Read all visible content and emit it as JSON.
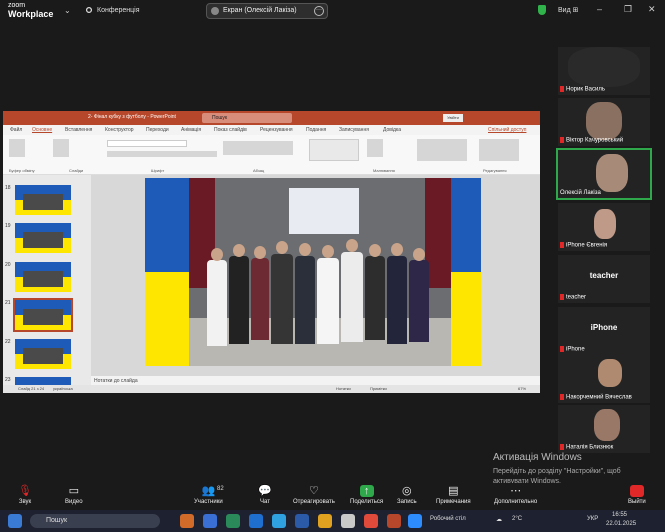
{
  "app": {
    "logo_line1": "zoom",
    "logo_line2": "Workplace",
    "conference_label": "Конференція"
  },
  "share_pill": {
    "label": "Екран (Олексій Лакіза)"
  },
  "topbar": {
    "view_label": "Вид"
  },
  "powerpoint": {
    "title": "2- Фінал кубку з футболу  -  PowerPoint",
    "search": "Пошук",
    "signin": "Увійти",
    "tabs": [
      "Файл",
      "Основне",
      "Вставлення",
      "Конструктор",
      "Переходи",
      "Анімація",
      "Показ слайдів",
      "Рецензування",
      "Подання",
      "Записування",
      "Довідка"
    ],
    "share_label": "Спільний доступ",
    "ribbon_groups": [
      "Буфер обміну",
      "Слайди",
      "Шрифт",
      "Абзац",
      "Малювання",
      "Редагування"
    ],
    "thumb_numbers": [
      "18",
      "19",
      "20",
      "21",
      "22",
      "23"
    ],
    "notes_label": "Нотатки до слайда",
    "status_left": "Слайд 21 з 24",
    "status_lang": "українська",
    "status_notes": "Нотатки",
    "status_comments": "Примітки",
    "zoom": "67%"
  },
  "gallery": [
    {
      "name": "Норик Василь",
      "video": true
    },
    {
      "name": "Віктор Качуровський",
      "video": true
    },
    {
      "name": "Олексій Лакіза",
      "video": true,
      "active": true
    },
    {
      "name": "iPhone Євгенія",
      "video": true
    },
    {
      "name": "teacher",
      "video": false
    },
    {
      "name": "iPhone",
      "video": false
    },
    {
      "name": "Накорчемний Вячеслав",
      "video": true
    },
    {
      "name": "Наталія Близнюк",
      "video": true
    }
  ],
  "gallery_placeholders": {
    "teacher": "teacher",
    "iphone": "iPhone"
  },
  "watermark": {
    "title": "Активація Windows",
    "line": "Перейдіть до розділу \"Настройки\", щоб активувати Windows."
  },
  "controls": {
    "audio": "Звук",
    "video": "Видео",
    "participants": "Участники",
    "participants_count": "82",
    "chat": "Чат",
    "react": "Отреагировать",
    "share": "Поделиться",
    "record": "Запись",
    "apps": "Приложения",
    "notes": "Примечания",
    "more": "Дополнительно",
    "end": "Выйти"
  },
  "taskbar": {
    "search": "Пошук",
    "zoom_label": "Робочий стіл",
    "temp": "2°C",
    "lang": "УКР",
    "time": "16:55",
    "date": "22.01.2025"
  },
  "colors": {
    "pp_red": "#b7472a",
    "active_green": "#2ea84a",
    "end_red": "#e02828"
  }
}
